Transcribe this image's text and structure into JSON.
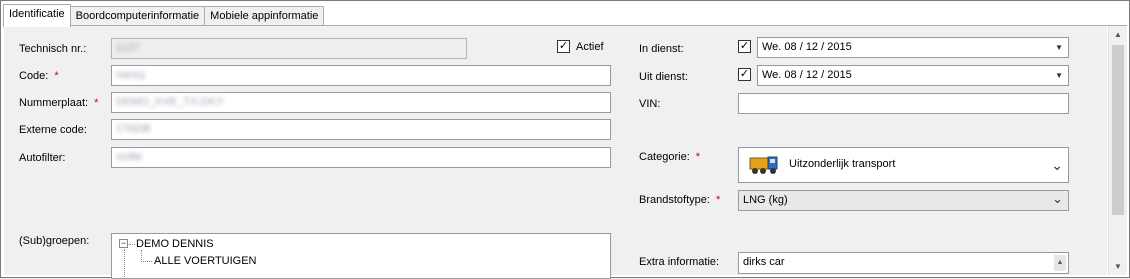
{
  "tabs": [
    {
      "label": "Identificatie",
      "active": true
    },
    {
      "label": "Boordcomputerinformatie",
      "active": false
    },
    {
      "label": "Mobiele appinformatie",
      "active": false
    }
  ],
  "left": {
    "technisch_nr": {
      "label": "Technisch nr.:",
      "value": "1137"
    },
    "code": {
      "label": "Code:",
      "required": "*",
      "value": "nancy"
    },
    "nummerplaat": {
      "label": "Nummerplaat:",
      "required": "*",
      "value": "DEMO_KVE_TX-DKY"
    },
    "externe_code": {
      "label": "Externe code:",
      "value": "1TADB"
    },
    "autofilter": {
      "label": "Autofilter:",
      "value": "vcdte"
    },
    "subgroepen": {
      "label": "(Sub)groepen:",
      "tree": [
        {
          "label": "DEMO DENNIS",
          "expander": "−"
        },
        {
          "label": "ALLE VOERTUIGEN"
        }
      ]
    }
  },
  "actief": {
    "label": "Actief",
    "checked": true,
    "mark": "✓"
  },
  "right": {
    "in_dienst": {
      "label": "In dienst:",
      "checked": true,
      "mark": "✓",
      "value": "We. 08 / 12 / 2015"
    },
    "uit_dienst": {
      "label": "Uit dienst:",
      "checked": true,
      "mark": "✓",
      "value": "We. 08 / 12 / 2015"
    },
    "vin": {
      "label": "VIN:",
      "value": ""
    },
    "categorie": {
      "label": "Categorie:",
      "required": "*",
      "value": "Uitzonderlijk transport",
      "icon": "truck-icon"
    },
    "brandstoftype": {
      "label": "Brandstoftype:",
      "required": "*",
      "value": "LNG (kg)"
    },
    "extra_informatie": {
      "label": "Extra informatie:",
      "value": "dirks car"
    }
  },
  "icons": {
    "dropdown": "▼",
    "chevron": "⌄",
    "scroll_up": "▲",
    "scroll_down": "▼"
  },
  "colors": {
    "required": "#d00000",
    "scroll_thumb": "#cdcdcd"
  }
}
